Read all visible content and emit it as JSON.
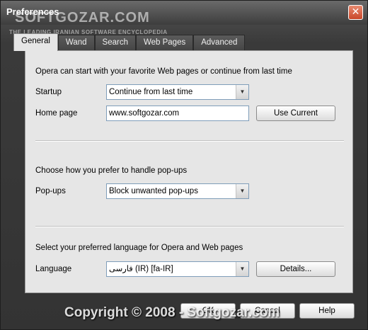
{
  "window": {
    "title": "Preferences",
    "close_label": "✕"
  },
  "watermark": {
    "top": "SOFTGOZAR.COM",
    "top_sub": "THE LEADING IRANIAN SOFTWARE ENCYCLOPEDIA",
    "bottom": "Copyright © 2008 - Softgozar.com"
  },
  "tabs": [
    {
      "label": "General",
      "active": true
    },
    {
      "label": "Wand"
    },
    {
      "label": "Search"
    },
    {
      "label": "Web Pages"
    },
    {
      "label": "Advanced"
    }
  ],
  "general": {
    "startup_intro": "Opera can start with your favorite Web pages or continue from last time",
    "startup_label": "Startup",
    "startup_value": "Continue from last time",
    "homepage_label": "Home page",
    "homepage_value": "www.softgozar.com",
    "use_current": "Use Current",
    "popups_intro": "Choose how you prefer to handle pop-ups",
    "popups_label": "Pop-ups",
    "popups_value": "Block unwanted pop-ups",
    "language_intro": "Select your preferred language for Opera and Web pages",
    "language_label": "Language",
    "language_value": "فارسی (IR) [fa-IR]",
    "details": "Details..."
  },
  "footer": {
    "ok": "OK",
    "cancel": "Cancel",
    "help": "Help"
  }
}
